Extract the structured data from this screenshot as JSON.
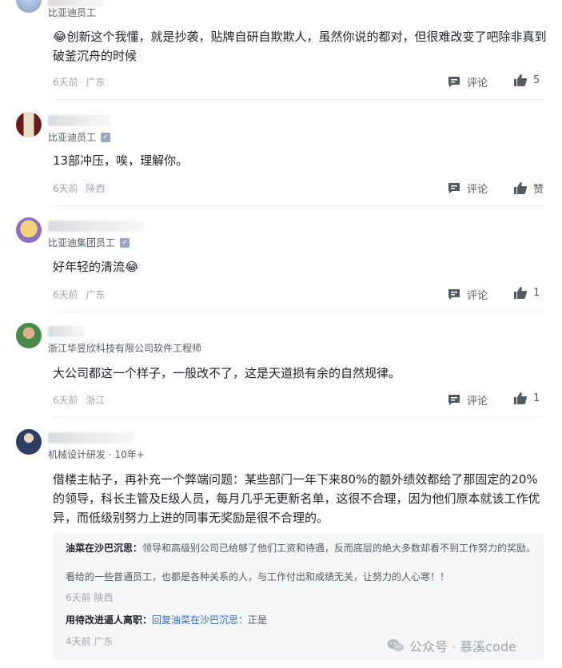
{
  "comments": [
    {
      "role": "比亚迪员工",
      "verified": false,
      "text": "😂创新这个我懂，就是抄袭，贴牌自研自欺欺人，虽然你说的都对，但很难改变了吧除非真到破釜沉舟的时候",
      "time": "6天前",
      "location": "广东",
      "comment_label": "评论",
      "like_label": "5"
    },
    {
      "role": "比亚迪员工",
      "verified": true,
      "text": "13部冲压，唉，理解你。",
      "time": "6天前",
      "location": "陕西",
      "comment_label": "评论",
      "like_label": "赞"
    },
    {
      "role": "比亚迪集团员工",
      "verified": true,
      "text": "好年轻的清流😂",
      "time": "6天前",
      "location": "广东",
      "comment_label": "评论",
      "like_label": "1"
    },
    {
      "role": "浙江华昱欣科技有限公司软件工程师",
      "verified": false,
      "text": "大公司都这一个样子，一般改不了，这是天道损有余的自然规律。",
      "time": "6天前",
      "location": "浙江",
      "comment_label": "评论",
      "like_label": "1"
    },
    {
      "role": "机械设计研发 · 10年+",
      "verified": false,
      "text": "借楼主帖子，再补充一个弊端问题：某些部门一年下来80%的额外绩效都给了那固定的20%的领导，科长主管及E级人员，每月几乎无更新名单，这很不合理，因为他们原本就该工作优异，而低级别努力上进的同事无奖励是很不合理的。"
    }
  ],
  "replies": [
    {
      "author": "油菜在沙巴沉思：",
      "text": "领导和高级别公司已给够了他们工资和待遇，反而底层的绝大多数却看不到工作努力的奖励。",
      "text2": "看给的一些普通员工，也都是各种关系的人，与工作付出和成绩无关，让努力的人心寒！！",
      "time": "6天前",
      "location": "陕西"
    },
    {
      "author": "用待改进逼人离职：",
      "reply_to": "回复油菜在沙巴沉思：",
      "text": "正是",
      "time": "4天前",
      "location": "广东"
    }
  ],
  "watermark": "公众号 · 慕溪code",
  "colors": {
    "link": "#2f6bd8",
    "meta": "#a3a8af"
  }
}
